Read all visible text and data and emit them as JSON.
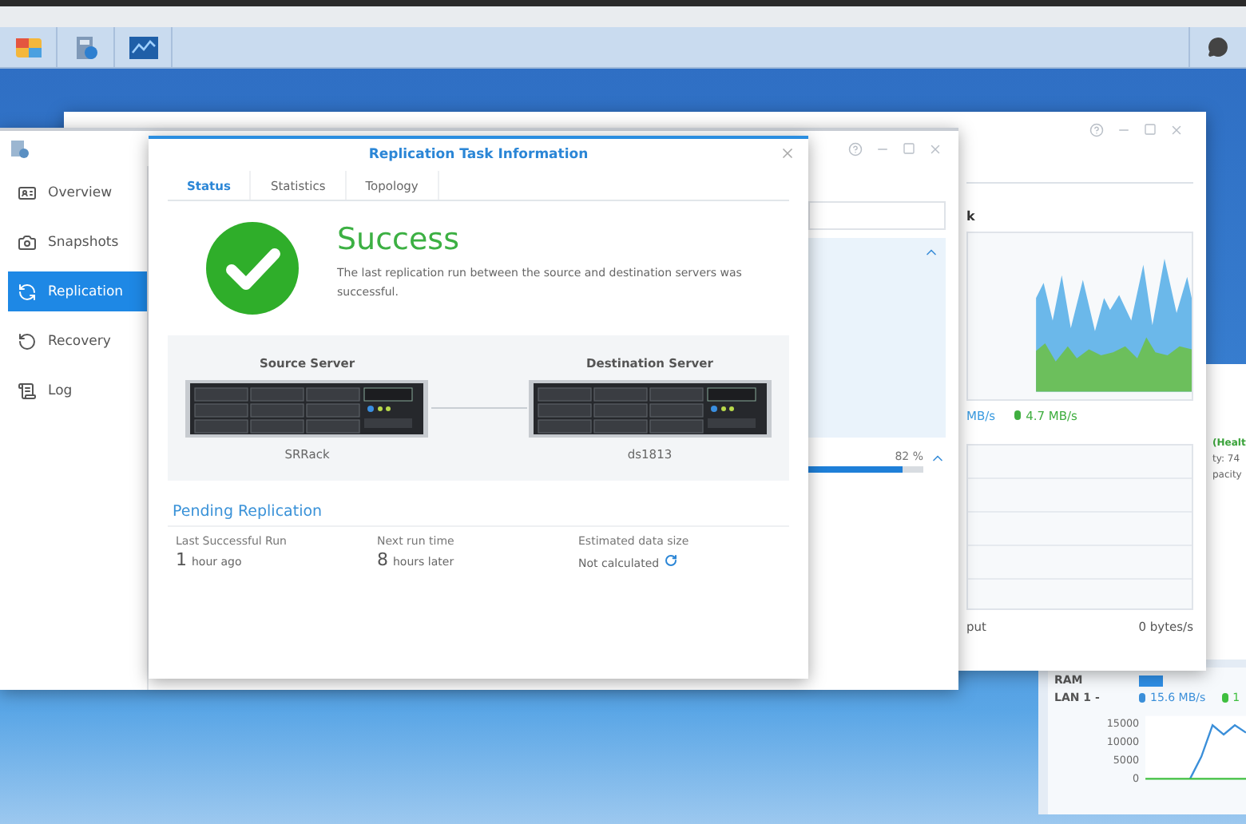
{
  "resource_monitor": {
    "header": "k",
    "legend": [
      {
        "text": "MB/s",
        "color": "#3b9be0"
      },
      {
        "text": "4.7 MB/s",
        "color": "#3fae3f"
      }
    ],
    "footer_label": "put",
    "footer_value": "0 bytes/s"
  },
  "replication_app": {
    "sidebar": [
      {
        "label": "Overview",
        "kind": "overview",
        "selected": false
      },
      {
        "label": "Snapshots",
        "kind": "snapshots",
        "selected": false
      },
      {
        "label": "Replication",
        "kind": "replication",
        "selected": true
      },
      {
        "label": "Recovery",
        "kind": "recovery",
        "selected": false
      },
      {
        "label": "Log",
        "kind": "log",
        "selected": false
      }
    ],
    "progress": {
      "reading": "82 %",
      "level": 0.82
    }
  },
  "dialog": {
    "title": "Replication Task Information",
    "tabs": [
      {
        "label": "Status",
        "selected": true
      },
      {
        "label": "Statistics",
        "selected": false
      },
      {
        "label": "Topology",
        "selected": false
      }
    ],
    "status": "Success",
    "description": "The last replication run between the source and destination servers was successful.",
    "servers": [
      {
        "heading": "Source Server",
        "name": "SRRack"
      },
      {
        "heading": "Destination Server",
        "name": "ds1813"
      }
    ],
    "pending": {
      "heading": "Pending Replication",
      "fields": [
        {
          "label": "Last Successful Run",
          "number": "1",
          "unit": "hour ago"
        },
        {
          "label": "Next run time",
          "number": "8",
          "unit": "hours later"
        },
        {
          "label": "Estimated data size",
          "value": "Not calculated"
        }
      ]
    }
  },
  "widget": {
    "health": "(Healt",
    "lines": [
      "ty: 74",
      "pacity"
    ],
    "ram_label": "RAM",
    "lan_label": "LAN 1 -",
    "lan_readings": [
      {
        "text": "15.6 MB/s",
        "color": "#3b8fd9"
      },
      {
        "text": "1",
        "color": "#3fbf3f"
      }
    ],
    "chart_data": {
      "type": "line",
      "yticks": [
        0,
        5000,
        10000,
        15000
      ],
      "ylim": [
        0,
        17000
      ],
      "series": [
        {
          "color": "#3b8fd9",
          "values": [
            null,
            null,
            null,
            null,
            0,
            6000,
            14500,
            12000,
            14500,
            12500
          ]
        },
        {
          "color": "#3fbf3f",
          "values": [
            0,
            0,
            0,
            0,
            0,
            0,
            0,
            0,
            0,
            0
          ]
        }
      ]
    }
  }
}
